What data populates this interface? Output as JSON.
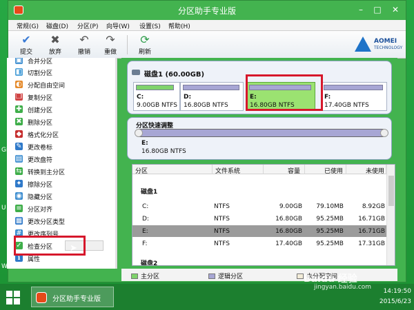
{
  "window": {
    "title": "分区助手专业版",
    "minimize": "–",
    "maximize": "□",
    "close": "✕"
  },
  "menu": [
    "常规(G)",
    "磁盘(D)",
    "分区(P)",
    "向导(W)",
    "设置(S)",
    "帮助(H)"
  ],
  "toolbar": {
    "buttons": [
      "提交",
      "放弃",
      "撤销",
      "重做",
      "刷新"
    ]
  },
  "logo": {
    "brand": "AOMEI",
    "sub": "TECHNOLOGY"
  },
  "operations": [
    "合并分区",
    "切割分区",
    "分配自由空间",
    "复制分区",
    "创建分区",
    "删除分区",
    "格式化分区",
    "更改卷标",
    "更改盘符",
    "转换到主分区",
    "擦除分区",
    "隐藏分区",
    "分区对齐",
    "更改分区类型",
    "更改序列号",
    "检查分区",
    "属性"
  ],
  "disk": {
    "header": "磁盘1 (60.00GB)",
    "partitions": [
      {
        "letter": "C:",
        "size": "9.00GB NTFS",
        "fill": 0.95,
        "bar_color": "#7fd36b"
      },
      {
        "letter": "D:",
        "size": "16.80GB NTFS",
        "fill": 1.0,
        "bar_color": "#a7a6d4"
      },
      {
        "letter": "E:",
        "size": "16.80GB NTFS",
        "fill": 1.0,
        "bar_color": "#a7a6d4"
      },
      {
        "letter": "F:",
        "size": "17.40GB NTFS",
        "fill": 1.0,
        "bar_color": "#a7a6d4"
      }
    ]
  },
  "quick_adjust": {
    "title": "分区快速调整",
    "letter": "E:",
    "size": "16.80GB NTFS"
  },
  "table": {
    "headers": [
      "分区",
      "文件系统",
      "容量",
      "已使用",
      "未使用"
    ],
    "group": "磁盘1",
    "rows": [
      [
        "C:",
        "NTFS",
        "9.00GB",
        "79.10MB",
        "8.92GB"
      ],
      [
        "D:",
        "NTFS",
        "16.80GB",
        "95.25MB",
        "16.71GB"
      ],
      [
        "E:",
        "NTFS",
        "16.80GB",
        "95.25MB",
        "16.71GB"
      ],
      [
        "F:",
        "NTFS",
        "17.40GB",
        "95.25MB",
        "17.31GB"
      ]
    ],
    "partial_row": "磁盘2"
  },
  "legend": [
    "主分区",
    "逻辑分区",
    "未分配空间"
  ],
  "taskbar": {
    "app": "分区助手专业版",
    "time": "14:19:50",
    "date": "2015/6/23"
  },
  "watermark": {
    "brand": "Baidu 经验",
    "url": "jingyan.baidu.com"
  },
  "desktop_edge": [
    "Gi",
    "U",
    "W"
  ],
  "colors": {
    "accent": "#43b34f",
    "highlight": "#d6172b",
    "primary": "#7fd36b",
    "logical": "#a7a6d4"
  }
}
